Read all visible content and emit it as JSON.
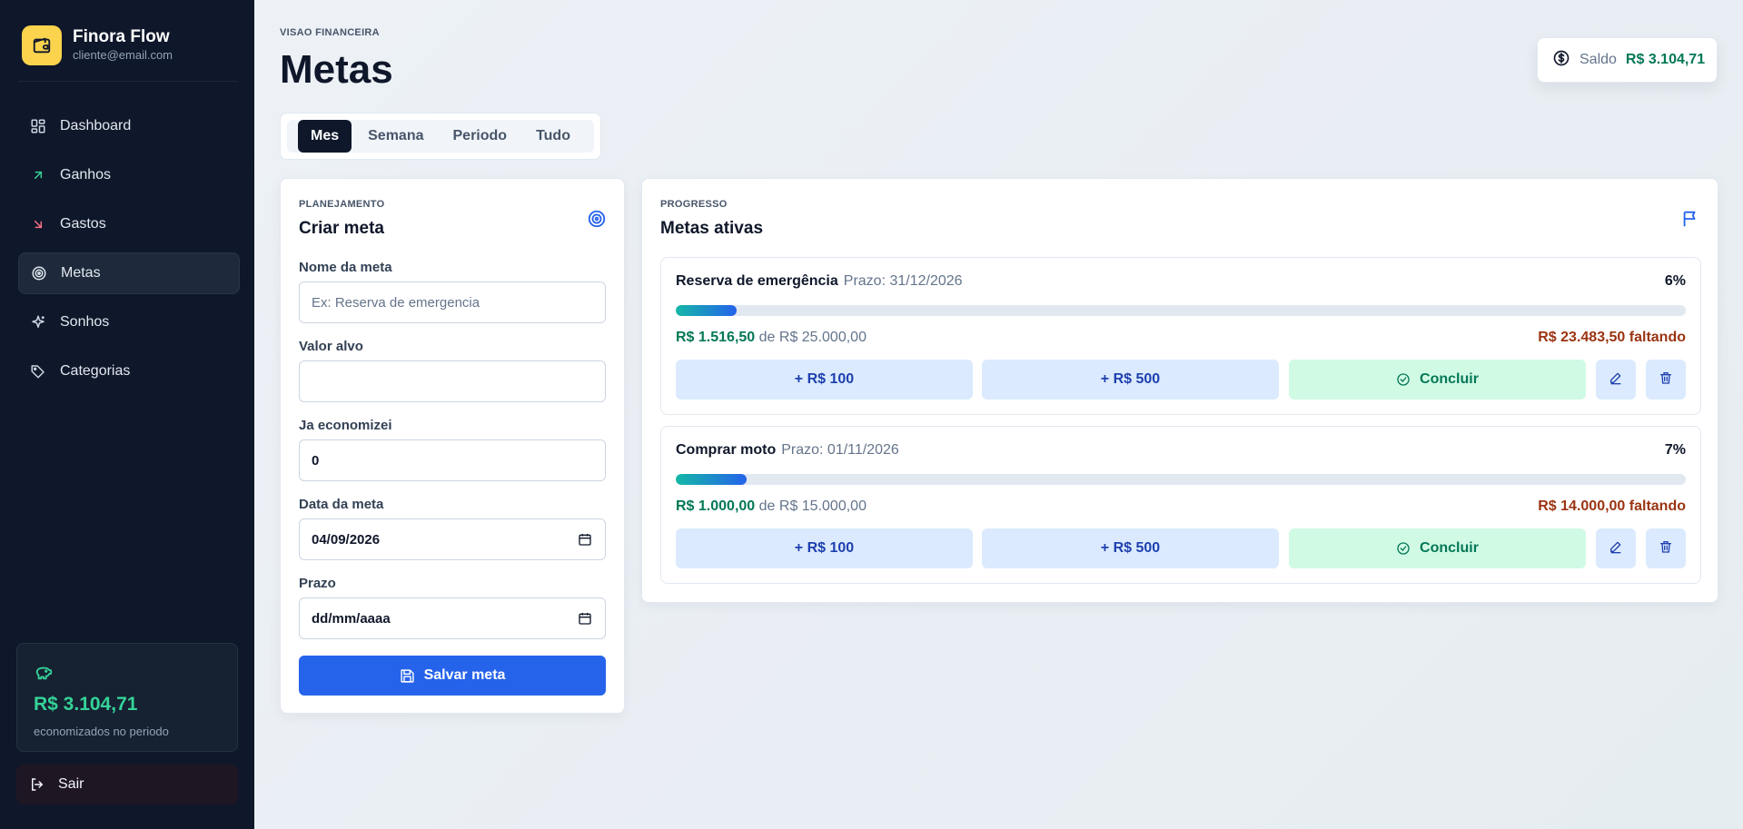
{
  "brand": {
    "name": "Finora Flow",
    "email": "cliente@email.com",
    "icon": "wallet-icon"
  },
  "sidebar": {
    "items": [
      {
        "label": "Dashboard",
        "icon": "dashboard-icon"
      },
      {
        "label": "Ganhos",
        "icon": "arrow-up-right-icon"
      },
      {
        "label": "Gastos",
        "icon": "arrow-down-right-icon"
      },
      {
        "label": "Metas",
        "icon": "target-icon",
        "active": true
      },
      {
        "label": "Sonhos",
        "icon": "sparkles-icon"
      },
      {
        "label": "Categorias",
        "icon": "tags-icon"
      }
    ],
    "savings": {
      "amount": "R$ 3.104,71",
      "caption": "economizados no periodo",
      "icon": "piggy-bank-icon"
    },
    "logout_label": "Sair"
  },
  "header": {
    "eyebrow": "VISAO FINANCEIRA",
    "title": "Metas",
    "balance": {
      "label": "Saldo",
      "value": "R$ 3.104,71",
      "icon": "dollar-circle-icon"
    }
  },
  "tabs": [
    "Mes",
    "Semana",
    "Periodo",
    "Tudo"
  ],
  "form": {
    "eyebrow": "PLANEJAMENTO",
    "title": "Criar meta",
    "fields": {
      "name_label": "Nome da meta",
      "name_placeholder": "Ex: Reserva de emergencia",
      "target_label": "Valor alvo",
      "saved_label": "Ja economizei",
      "saved_value": "0",
      "date_label": "Data da meta",
      "date_value": "04/09/2026",
      "deadline_label": "Prazo",
      "deadline_placeholder": "dd/mm/aaaa"
    },
    "save_label": "Salvar meta"
  },
  "progress": {
    "eyebrow": "PROGRESSO",
    "title": "Metas ativas",
    "goals": [
      {
        "name": "Reserva de emergência",
        "deadline": "Prazo: 31/12/2026",
        "percent": "6%",
        "percent_value": 6,
        "saved": "R$ 1.516,50",
        "of_target": "de R$ 25.000,00",
        "remaining": "R$ 23.483,50 faltando"
      },
      {
        "name": "Comprar moto",
        "deadline": "Prazo: 01/11/2026",
        "percent": "7%",
        "percent_value": 7,
        "saved": "R$ 1.000,00",
        "of_target": "de R$ 15.000,00",
        "remaining": "R$ 14.000,00 faltando"
      }
    ],
    "actions": {
      "add100": "+ R$ 100",
      "add500": "+ R$ 500",
      "complete": "Concluir"
    }
  },
  "colors": {
    "accent": "#2563eb",
    "success": "#047857",
    "warning": "#9a3412",
    "sidebar": "#0f172a",
    "brand": "#fcd34d"
  }
}
